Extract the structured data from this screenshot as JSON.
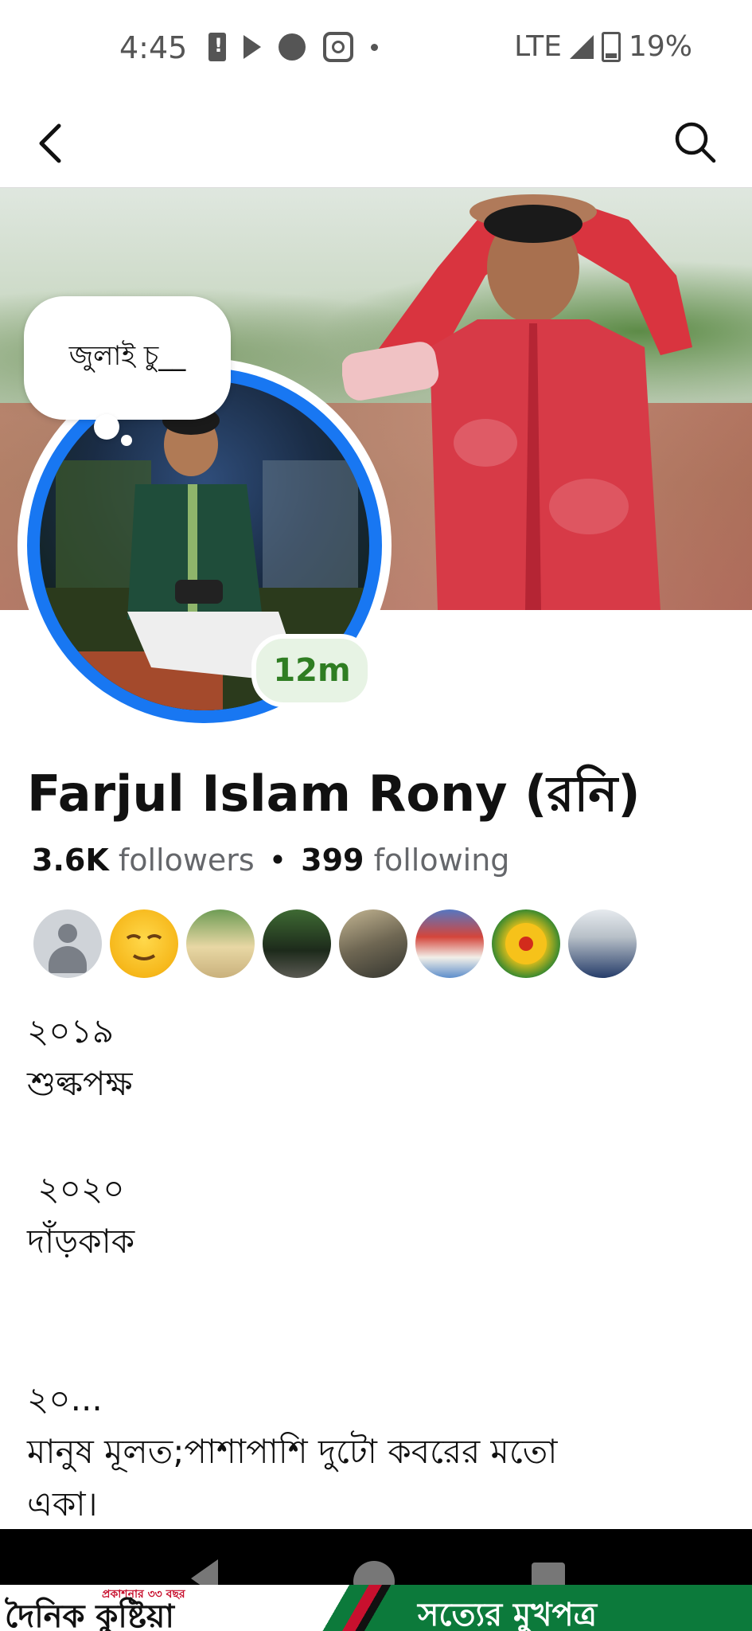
{
  "status_bar": {
    "time": "4:45",
    "network": "LTE",
    "battery": "19%",
    "icons": [
      "battery-alert-icon",
      "play-store-icon",
      "app-icon",
      "instagram-icon",
      "notification-dot-icon",
      "signal-icon",
      "battery-icon"
    ]
  },
  "app_bar": {
    "icons": [
      "back-arrow-icon",
      "search-icon"
    ]
  },
  "profile": {
    "note": "জুলাই চু__",
    "active_badge": "12m",
    "name": "Farjul Islam Rony (রনি)",
    "followers_count": "3.6K",
    "followers_label": "followers",
    "separator": "•",
    "following_count": "399",
    "following_label": "following",
    "friend_count_shown": 8
  },
  "bio": {
    "lines": [
      "২০১৯",
      "শুল্কপক্ষ",
      "",
      " ২০২০",
      "দাঁড়কাক",
      "",
      "",
      "২০...",
      "মানুষ মূলত;পাশাপাশি দুটো কবরের মতো",
      "একা।"
    ]
  },
  "watermark": {
    "left_title": "দৈনিক কুষ্টিয়া",
    "left_small": "প্রকাশনার ৩৩ বছর",
    "right_title": "সত্যের মুখপত্র"
  },
  "colors": {
    "accent": "#1877f2",
    "active_green": "#2f7d22",
    "active_bg": "#e7f3e4",
    "secondary_text": "#65676b"
  }
}
